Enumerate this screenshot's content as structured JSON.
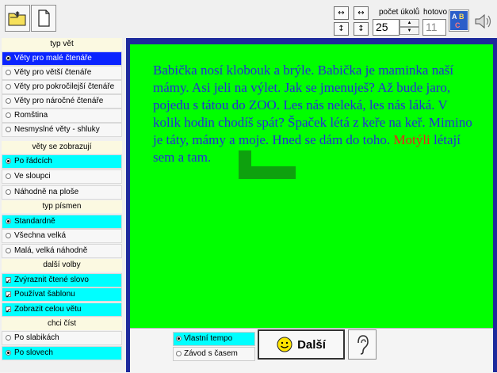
{
  "toolbar": {
    "open_button": "folder-icon",
    "new_button": "new-document-icon",
    "pocet_ukolu_label": "počet úkolů",
    "pocet_ukolu_value": "25",
    "hotovo_label": "hotovo",
    "hotovo_value": "11",
    "arrow_buttons": [
      "↔",
      "↔",
      "↕",
      "↕"
    ],
    "spell_icon": "abc-spelling-icon",
    "sound_icon": "speaker-icon"
  },
  "sidebar": {
    "typ_vet": {
      "header": "typ vět",
      "items": [
        {
          "label": "Věty pro malé čtenáře",
          "checked": true
        },
        {
          "label": "Věty pro větší čtenáře",
          "checked": false
        },
        {
          "label": "Věty pro pokročilejší čtenáře",
          "checked": false
        },
        {
          "label": "Věty pro náročné čtenáře",
          "checked": false
        },
        {
          "label": "Romština",
          "checked": false
        },
        {
          "label": "Nesmyslné věty - shluky",
          "checked": false
        }
      ]
    },
    "zobrazeni": {
      "header": "věty se zobrazují",
      "items": [
        {
          "label": "Po řádcích",
          "checked": true
        },
        {
          "label": "Ve sloupci",
          "checked": false
        },
        {
          "label": "Náhodně na ploše",
          "checked": false
        }
      ]
    },
    "pismena": {
      "header": "typ písmen",
      "items": [
        {
          "label": "Standardně",
          "checked": true
        },
        {
          "label": "Všechna velká",
          "checked": false
        },
        {
          "label": "Malá, velká náhodně",
          "checked": false
        }
      ]
    },
    "volby": {
      "header": "další volby",
      "items": [
        {
          "label": "Zvýraznit čtené slovo",
          "checked": true
        },
        {
          "label": "Používat šablonu",
          "checked": true
        },
        {
          "label": "Zobrazit celou větu",
          "checked": true
        }
      ]
    },
    "cist": {
      "header": "chci číst",
      "items": [
        {
          "label": "Po slabikách",
          "checked": false
        },
        {
          "label": "Po slovech",
          "checked": true
        }
      ]
    }
  },
  "reading": {
    "text_before": "Babička nosí klobouk a brýle. Babička je maminka naší mámy. Asi jeli na výlet. Jak se jmenuješ? Až bude jaro, pojedu s tátou do ZOO. Les nás neleká, les nás láká. V kolik hodin chodíš spát? Špaček létá z keře na keř. Mimino je táty, mámy a moje. Hned se dám do toho.",
    "highlight_word": "Motýli",
    "text_after": "létají sem a tam.",
    "colors": {
      "text": "#2430d4",
      "highlight": "#ee1f1f",
      "background": "#00ff00",
      "shade": "#0ea10e"
    }
  },
  "bottom": {
    "mode_1": "Vlastní tempo",
    "mode_2": "Závod s časem",
    "next_label": "Další",
    "next_icon": "smiley-icon",
    "listen_icon": "ear-icon"
  }
}
